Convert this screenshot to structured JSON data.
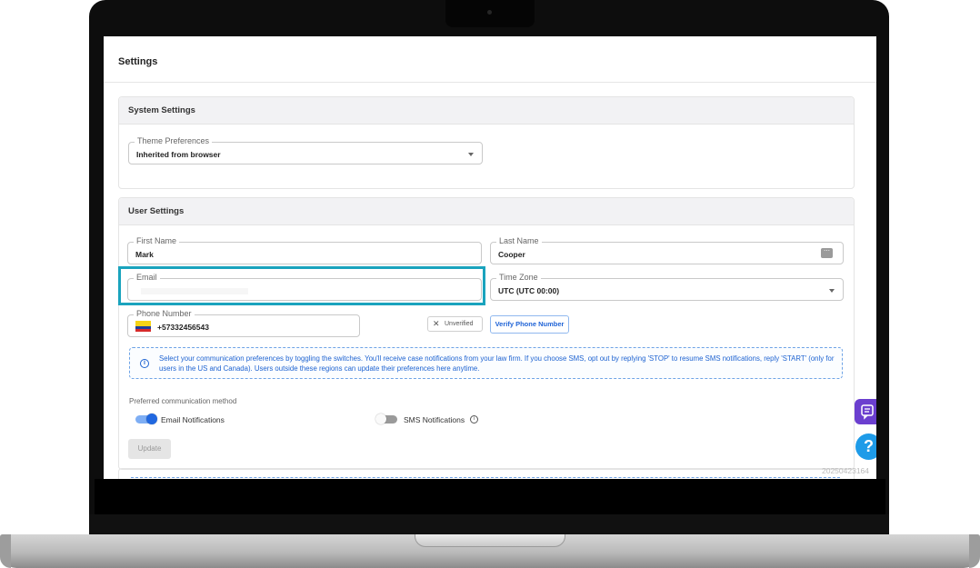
{
  "header": {
    "title": "Settings"
  },
  "system_settings": {
    "title": "System Settings",
    "theme": {
      "label": "Theme Preferences",
      "value": "Inherited from browser"
    }
  },
  "user_settings": {
    "title": "User Settings",
    "first_name": {
      "label": "First Name",
      "value": "Mark"
    },
    "last_name": {
      "label": "Last Name",
      "value": "Cooper"
    },
    "email": {
      "label": "Email",
      "value": ""
    },
    "time_zone": {
      "label": "Time Zone",
      "value": "UTC (UTC 00:00)"
    },
    "phone": {
      "label": "Phone Number",
      "value": "+57332456543",
      "country_flag": "Colombia"
    },
    "verification": {
      "status": "Unverified",
      "button": "Verify Phone Number"
    },
    "info_text": "Select your communication preferences by toggling the switches. You'll receive case notifications from your law firm. If you choose SMS, opt out by replying 'STOP' to resume SMS notifications, reply 'START' (only for users in the US and Canada). Users outside these regions can update their preferences here anytime.",
    "preferred_method_label": "Preferred communication method",
    "email_notifications": {
      "label": "Email Notifications",
      "enabled": true
    },
    "sms_notifications": {
      "label": "SMS Notifications",
      "enabled": false
    },
    "update_button": "Update"
  },
  "build_id": "20250423164",
  "colors": {
    "accent": "#1f63d6",
    "highlight": "#1aa3bd",
    "chat": "#6b3fcf",
    "help": "#1e9be8"
  },
  "icons": {
    "chat": "chat-icon",
    "help": "help-icon",
    "info": "info-icon",
    "dropdown": "chevron-down-icon",
    "more": "more-icon"
  }
}
